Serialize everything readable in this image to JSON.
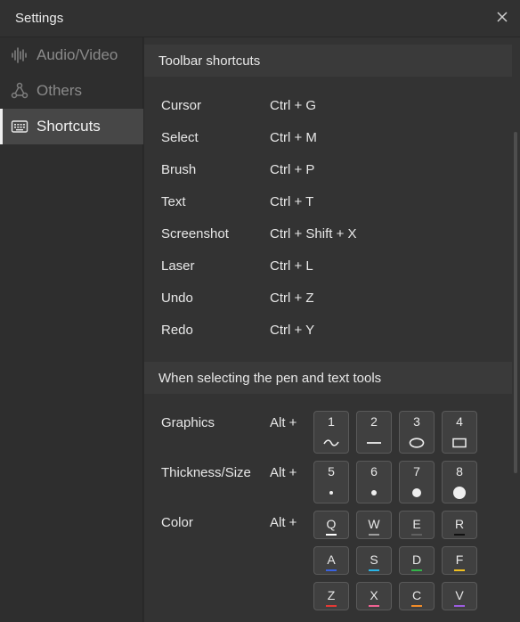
{
  "window": {
    "title": "Settings",
    "close_icon": "close-icon"
  },
  "sidebar": {
    "items": [
      {
        "label": "Audio/Video",
        "icon": "audio-waveform-icon",
        "active": false
      },
      {
        "label": "Others",
        "icon": "share-nodes-icon",
        "active": false
      },
      {
        "label": "Shortcuts",
        "icon": "keyboard-icon",
        "active": true
      }
    ]
  },
  "toolbar_section": {
    "header": "Toolbar shortcuts",
    "rows": [
      {
        "name": "Cursor",
        "keys": "Ctrl + G"
      },
      {
        "name": "Select",
        "keys": "Ctrl + M"
      },
      {
        "name": "Brush",
        "keys": "Ctrl + P"
      },
      {
        "name": "Text",
        "keys": "Ctrl + T"
      },
      {
        "name": "Screenshot",
        "keys": "Ctrl + Shift + X"
      },
      {
        "name": "Laser",
        "keys": "Ctrl + L"
      },
      {
        "name": "Undo",
        "keys": "Ctrl + Z"
      },
      {
        "name": "Redo",
        "keys": "Ctrl + Y"
      }
    ]
  },
  "pen_section": {
    "header": "When selecting the pen and text tools",
    "modifier": "Alt +",
    "graphics": {
      "label": "Graphics",
      "keys": [
        {
          "key": "1",
          "icon": "wave-line-icon"
        },
        {
          "key": "2",
          "icon": "straight-line-icon"
        },
        {
          "key": "3",
          "icon": "ellipse-icon"
        },
        {
          "key": "4",
          "icon": "rectangle-icon"
        }
      ]
    },
    "thickness": {
      "label": "Thickness/Size",
      "keys": [
        {
          "key": "5",
          "icon": "dot-xs-icon"
        },
        {
          "key": "6",
          "icon": "dot-s-icon"
        },
        {
          "key": "7",
          "icon": "dot-m-icon"
        },
        {
          "key": "8",
          "icon": "dot-l-icon"
        }
      ]
    },
    "color": {
      "label": "Color",
      "keys": [
        {
          "key": "Q",
          "color": "#ffffff"
        },
        {
          "key": "W",
          "color": "#9e9e9e"
        },
        {
          "key": "E",
          "color": "#616161"
        },
        {
          "key": "R",
          "color": "#111111"
        },
        {
          "key": "A",
          "color": "#3a62e0"
        },
        {
          "key": "S",
          "color": "#29b6e8"
        },
        {
          "key": "D",
          "color": "#33b54a"
        },
        {
          "key": "F",
          "color": "#f0c020"
        },
        {
          "key": "Z",
          "color": "#e53935"
        },
        {
          "key": "X",
          "color": "#f06292"
        },
        {
          "key": "C",
          "color": "#f28c28"
        },
        {
          "key": "V",
          "color": "#9c5ce0"
        }
      ]
    }
  }
}
